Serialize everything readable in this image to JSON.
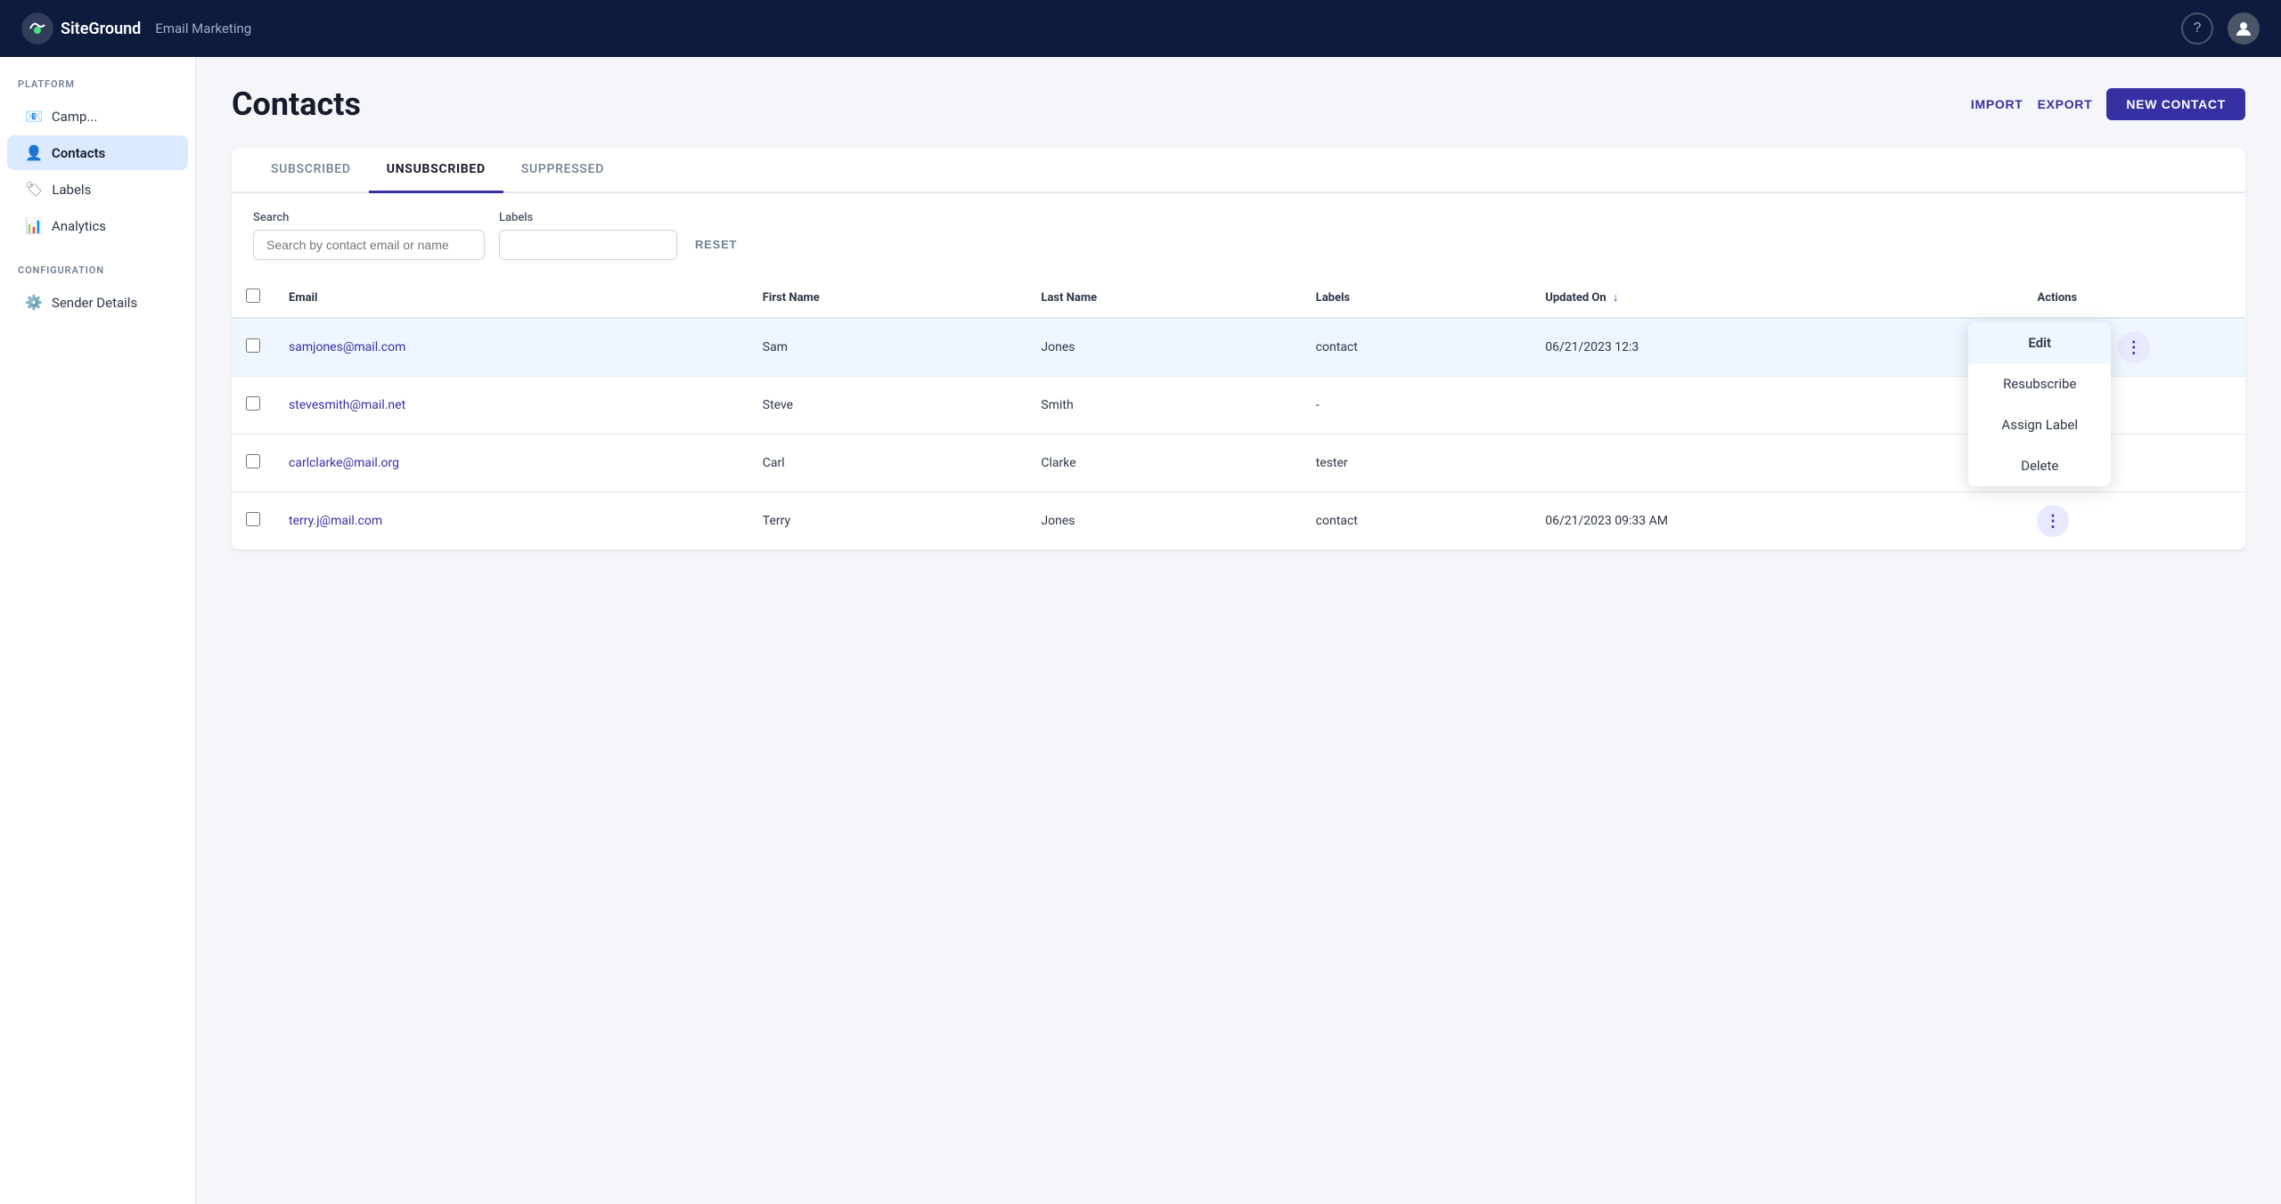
{
  "app": {
    "name": "SiteGround",
    "module": "Email Marketing"
  },
  "header": {
    "title": "Contacts",
    "import_label": "IMPORT",
    "export_label": "EXPORT",
    "new_contact_label": "NEW CONTACT"
  },
  "sidebar": {
    "platform_label": "PLATFORM",
    "configuration_label": "CONFIGURATION",
    "items": [
      {
        "id": "campaigns",
        "label": "Camp..."
      },
      {
        "id": "contacts",
        "label": "Contacts",
        "active": true
      },
      {
        "id": "labels",
        "label": "Labels"
      },
      {
        "id": "analytics",
        "label": "Analytics"
      }
    ],
    "config_items": [
      {
        "id": "sender-details",
        "label": "Sender Details"
      }
    ]
  },
  "tabs": [
    {
      "id": "subscribed",
      "label": "SUBSCRIBED"
    },
    {
      "id": "unsubscribed",
      "label": "UNSUBSCRIBED",
      "active": true
    },
    {
      "id": "suppressed",
      "label": "SUPPRESSED"
    }
  ],
  "filters": {
    "search_label": "Search",
    "search_placeholder": "Search by contact email or name",
    "labels_label": "Labels",
    "labels_placeholder": "",
    "reset_label": "RESET"
  },
  "table": {
    "columns": [
      {
        "id": "email",
        "label": "Email"
      },
      {
        "id": "first_name",
        "label": "First Name"
      },
      {
        "id": "last_name",
        "label": "Last Name"
      },
      {
        "id": "labels",
        "label": "Labels"
      },
      {
        "id": "updated_on",
        "label": "Updated On",
        "sortable": true
      },
      {
        "id": "actions",
        "label": "Actions"
      }
    ],
    "rows": [
      {
        "id": 1,
        "email": "samjones@mail.com",
        "first_name": "Sam",
        "last_name": "Jones",
        "labels": "contact",
        "updated_on": "06/21/2023 12:3",
        "highlighted": true,
        "show_dropdown": true
      },
      {
        "id": 2,
        "email": "stevesmith@mail.net",
        "first_name": "Steve",
        "last_name": "Smith",
        "labels": "-",
        "updated_on": "",
        "highlighted": false,
        "show_dropdown": false
      },
      {
        "id": 3,
        "email": "carlclarke@mail.org",
        "first_name": "Carl",
        "last_name": "Clarke",
        "labels": "tester",
        "updated_on": "",
        "highlighted": false,
        "show_dropdown": false
      },
      {
        "id": 4,
        "email": "terry.j@mail.com",
        "first_name": "Terry",
        "last_name": "Jones",
        "labels": "contact",
        "updated_on": "06/21/2023 09:33 AM",
        "highlighted": false,
        "show_dropdown": false
      }
    ]
  },
  "dropdown": {
    "edit_label": "Edit",
    "resubscribe_label": "Resubscribe",
    "assign_label_label": "Assign Label",
    "delete_label": "Delete"
  }
}
